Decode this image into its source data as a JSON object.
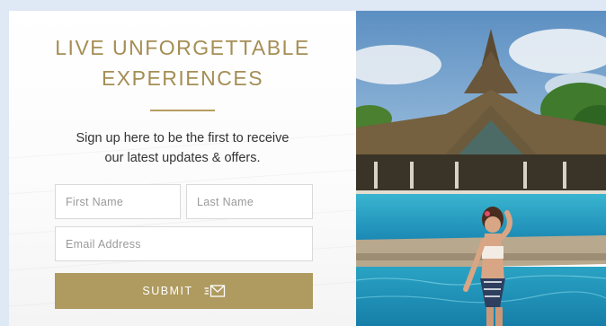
{
  "heading": {
    "line1": "LIVE UNFORGETTABLE",
    "line2": "EXPERIENCES"
  },
  "intro": {
    "line1": "Sign up here to be the first to receive",
    "line2": "our latest updates & offers."
  },
  "form": {
    "first_name_placeholder": "First Name",
    "last_name_placeholder": "Last Name",
    "email_placeholder": "Email Address",
    "submit_label": "SUBMIT"
  },
  "icons": {
    "submit": "envelope-send-icon"
  },
  "colors": {
    "accent": "#a58e55",
    "button": "#af9a5f",
    "background": "#dfe8f5"
  }
}
